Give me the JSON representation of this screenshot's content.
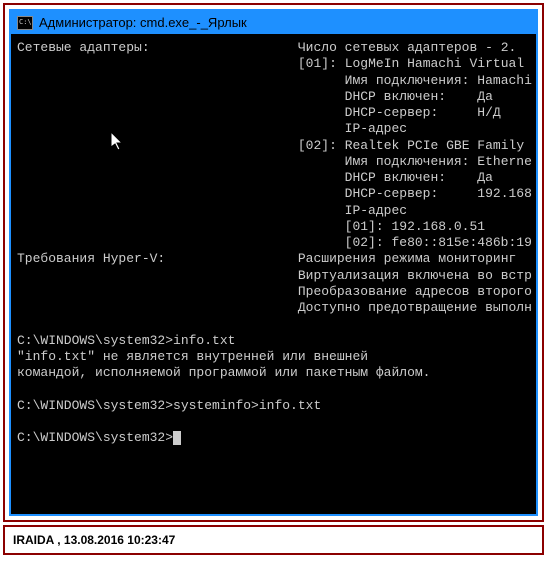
{
  "window": {
    "title": "Администратор: cmd.exe_-_Ярлык"
  },
  "terminal": {
    "section1_label": "Сетевые адаптеры:",
    "adapters_count": "Число сетевых адаптеров - 2.",
    "a1_idx": "[01]:",
    "a1_name": "LogMeIn Hamachi Virtual",
    "a1_conn_label": "Имя подключения:",
    "a1_conn_value": "Hamachi",
    "a1_dhcp_label": "DHCP включен:",
    "a1_dhcp_value": "Да",
    "a1_dhcpsrv_label": "DHCP-сервер:",
    "a1_dhcpsrv_value": "Н/Д",
    "a1_ip_label": "IP-адрес",
    "a2_idx": "[02]:",
    "a2_name": "Realtek PCIe GBE Family",
    "a2_conn_label": "Имя подключения:",
    "a2_conn_value": "Etherne",
    "a2_dhcp_label": "DHCP включен:",
    "a2_dhcp_value": "Да",
    "a2_dhcpsrv_label": "DHCP-сервер:",
    "a2_dhcpsrv_value": "192.168",
    "a2_ip_label": "IP-адрес",
    "a2_ip1": "[01]: 192.168.0.51",
    "a2_ip2": "[02]: fe80::815e:486b:19",
    "section2_label": "Требования Hyper-V:",
    "hv_line1": "Расширения режима мониторинг",
    "hv_line2": "Виртуализация включена во встр",
    "hv_line3": "Преобразование адресов второго",
    "hv_line4": "Доступно предотвращение выполн",
    "prompt1": "C:\\WINDOWS\\system32>",
    "cmd1": "info.txt",
    "err_line1": "\"info.txt\" не является внутренней или внешней",
    "err_line2": "командой, исполняемой программой или пакетным файлом.",
    "prompt2": "C:\\WINDOWS\\system32>",
    "cmd2": "systeminfo>info.txt",
    "prompt3": "C:\\WINDOWS\\system32>"
  },
  "footer": {
    "text": "IRAIDA  ,  13.08.2016 10:23:47"
  }
}
